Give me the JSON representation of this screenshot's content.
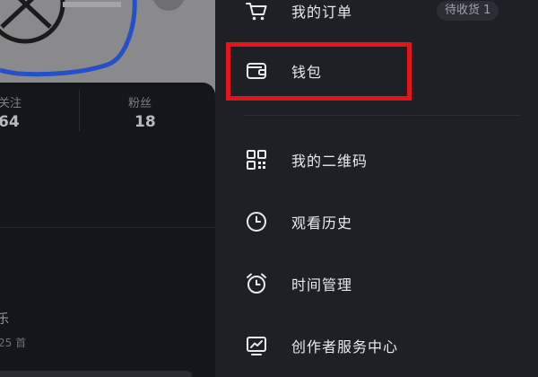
{
  "profile": {
    "stats": [
      {
        "label": "关注",
        "value": "64"
      },
      {
        "label": "粉丝",
        "value": "18"
      }
    ],
    "music": {
      "title": "乐",
      "count": "25 首"
    }
  },
  "drawer": {
    "items": [
      {
        "label": "我的订单",
        "icon": "cart-icon",
        "badge": "待收货 1"
      },
      {
        "label": "钱包",
        "icon": "wallet-icon"
      },
      {
        "label": "我的二维码",
        "icon": "qr-code-icon"
      },
      {
        "label": "观看历史",
        "icon": "clock-icon"
      },
      {
        "label": "时间管理",
        "icon": "alarm-clock-icon"
      },
      {
        "label": "创作者服务中心",
        "icon": "chart-monitor-icon"
      }
    ],
    "highlight_color": "#e3141b"
  },
  "colors": {
    "drawer_bg": "#1f2026",
    "text": "#e9eaee",
    "muted": "#7d7f86"
  }
}
